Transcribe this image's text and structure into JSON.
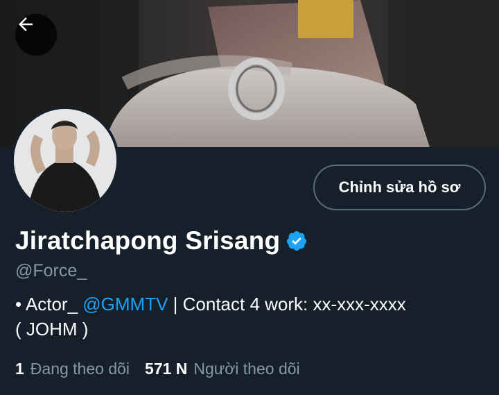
{
  "header": {
    "back_icon": "arrow-left-icon",
    "banner_description_icon": "banner-image"
  },
  "profile": {
    "edit_button_label": "Chỉnh sửa hồ sơ",
    "name": "Jiratchapong Srisang",
    "handle": "@Force_",
    "verified_icon": "verified-badge-icon",
    "bio_prefix": "• Actor_ ",
    "bio_mention": "@GMMTV",
    "bio_suffix": " | Contact 4 work: xx-xxx-xxxx",
    "bio_line2": "( JOHM )"
  },
  "stats": {
    "following_count": "1",
    "following_label": "Đang theo dõi",
    "followers_count": "571 N",
    "followers_label": "Người theo dõi"
  },
  "colors": {
    "background": "#15202b",
    "accent": "#1da1f2",
    "secondary_text": "#8899a6"
  }
}
